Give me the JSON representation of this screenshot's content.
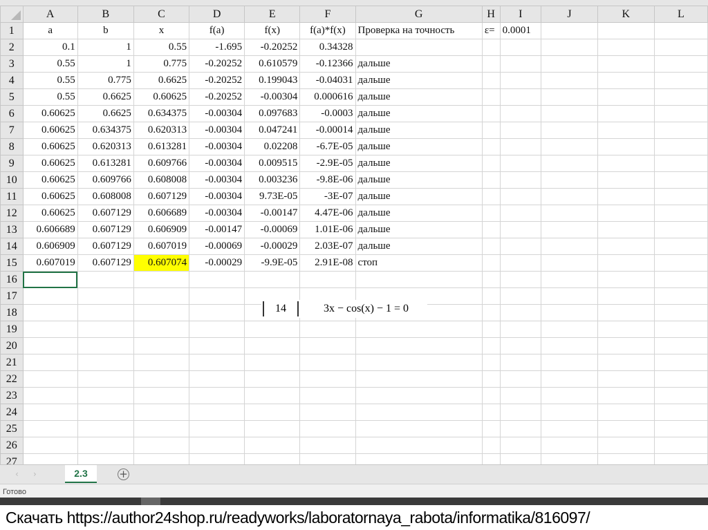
{
  "columns": [
    "A",
    "B",
    "C",
    "D",
    "E",
    "F",
    "G",
    "H",
    "I",
    "J",
    "K",
    "L"
  ],
  "rows": [
    [
      "a",
      "b",
      "x",
      "f(a)",
      "f(x)",
      "f(a)*f(x)",
      "Проверка на точность",
      "ε=",
      "0.0001",
      "",
      "",
      ""
    ],
    [
      "0.1",
      "1",
      "0.55",
      "-1.695",
      "-0.20252",
      "0.34328",
      "",
      "",
      "",
      "",
      "",
      ""
    ],
    [
      "0.55",
      "1",
      "0.775",
      "-0.20252",
      "0.610579",
      "-0.12366",
      "дальше",
      "",
      "",
      "",
      "",
      ""
    ],
    [
      "0.55",
      "0.775",
      "0.6625",
      "-0.20252",
      "0.199043",
      "-0.04031",
      "дальше",
      "",
      "",
      "",
      "",
      ""
    ],
    [
      "0.55",
      "0.6625",
      "0.60625",
      "-0.20252",
      "-0.00304",
      "0.000616",
      "дальше",
      "",
      "",
      "",
      "",
      ""
    ],
    [
      "0.60625",
      "0.6625",
      "0.634375",
      "-0.00304",
      "0.097683",
      "-0.0003",
      "дальше",
      "",
      "",
      "",
      "",
      ""
    ],
    [
      "0.60625",
      "0.634375",
      "0.620313",
      "-0.00304",
      "0.047241",
      "-0.00014",
      "дальше",
      "",
      "",
      "",
      "",
      ""
    ],
    [
      "0.60625",
      "0.620313",
      "0.613281",
      "-0.00304",
      "0.02208",
      "-6.7E-05",
      "дальше",
      "",
      "",
      "",
      "",
      ""
    ],
    [
      "0.60625",
      "0.613281",
      "0.609766",
      "-0.00304",
      "0.009515",
      "-2.9E-05",
      "дальше",
      "",
      "",
      "",
      "",
      ""
    ],
    [
      "0.60625",
      "0.609766",
      "0.608008",
      "-0.00304",
      "0.003236",
      "-9.8E-06",
      "дальше",
      "",
      "",
      "",
      "",
      ""
    ],
    [
      "0.60625",
      "0.608008",
      "0.607129",
      "-0.00304",
      "9.73E-05",
      "-3E-07",
      "дальше",
      "",
      "",
      "",
      "",
      ""
    ],
    [
      "0.60625",
      "0.607129",
      "0.606689",
      "-0.00304",
      "-0.00147",
      "4.47E-06",
      "дальше",
      "",
      "",
      "",
      "",
      ""
    ],
    [
      "0.606689",
      "0.607129",
      "0.606909",
      "-0.00147",
      "-0.00069",
      "1.01E-06",
      "дальше",
      "",
      "",
      "",
      "",
      ""
    ],
    [
      "0.606909",
      "0.607129",
      "0.607019",
      "-0.00069",
      "-0.00029",
      "2.03E-07",
      "дальше",
      "",
      "",
      "",
      "",
      ""
    ],
    [
      "0.607019",
      "0.607129",
      "0.607074",
      "-0.00029",
      "-9.9E-05",
      "2.91E-08",
      "стоп",
      "",
      "",
      "",
      "",
      ""
    ]
  ],
  "total_rows": 27,
  "highlight_color": "#ffff00",
  "formula": {
    "number": "14",
    "equation": "3x − cos(x) − 1 = 0"
  },
  "sheet_tabs": [
    {
      "label": "2.3",
      "active": true
    }
  ],
  "nav_prev": "‹",
  "nav_next": "›",
  "add_sheet": "+",
  "status": "Готово",
  "footer": "Скачать https://author24shop.ru/readyworks/laboratornaya_rabota/informatika/816097/"
}
